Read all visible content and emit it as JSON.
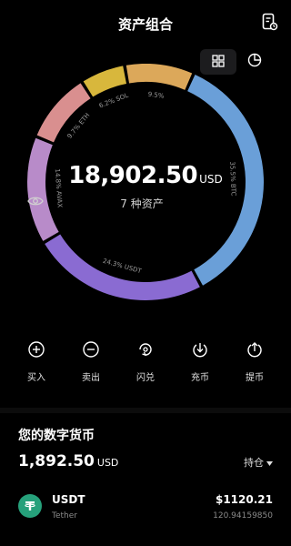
{
  "header": {
    "title": "资产组合"
  },
  "total": {
    "amount": "18,902.50",
    "unit": "USD",
    "count_label": "7 种资产"
  },
  "chart_data": {
    "type": "pie",
    "slices": [
      {
        "name": "BTC",
        "value": 35.5,
        "label": "35.5% BTC",
        "color": "#6a9fd8"
      },
      {
        "name": "USDT",
        "value": 24.3,
        "label": "24.3% USDT",
        "color": "#8a6bd2"
      },
      {
        "name": "AVAX",
        "value": 14.8,
        "label": "14.8% AVAX",
        "color": "#b88bc9"
      },
      {
        "name": "ETH",
        "value": 9.7,
        "label": "9.7% ETH",
        "color": "#d98f8f"
      },
      {
        "name": "SOL",
        "value": 6.2,
        "label": "6.2% SOL",
        "color": "#d8b73c"
      },
      {
        "name": "other",
        "value": 9.5,
        "label": "9.5%",
        "color": "#dca85a"
      }
    ]
  },
  "actions": [
    {
      "label": "买入",
      "icon": "plus-circle-icon"
    },
    {
      "label": "卖出",
      "icon": "minus-circle-icon"
    },
    {
      "label": "闪兑",
      "icon": "swap-circle-icon"
    },
    {
      "label": "充币",
      "icon": "deposit-icon"
    },
    {
      "label": "提币",
      "icon": "withdraw-icon"
    }
  ],
  "holdings": {
    "title": "您的数字货币",
    "amount": "1,892.50",
    "unit": "USD",
    "sort_label": "持仓",
    "assets": [
      {
        "symbol": "USDT",
        "name": "Tether",
        "value": "$1120.21",
        "quantity": "120.94159850"
      }
    ]
  }
}
